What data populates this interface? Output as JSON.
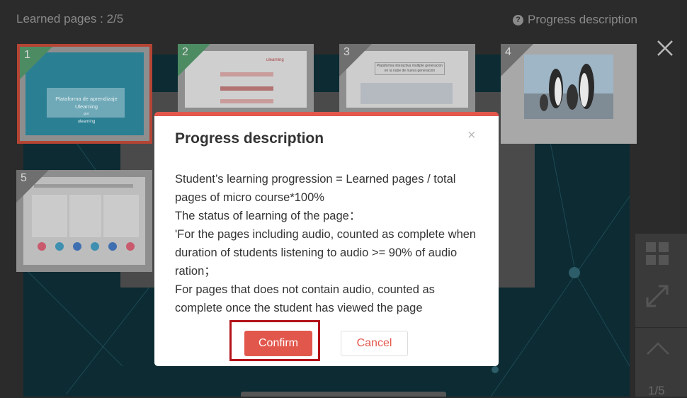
{
  "header": {
    "learned_pages": "Learned pages : 2/5",
    "progress_description_link": "Progress description"
  },
  "thumbnails": [
    {
      "number": "1",
      "status": "learned",
      "selected": true,
      "text": {
        "line1": "Plataforma de aprendizaje",
        "line2": "Ulearning",
        "brand": "ulearning",
        "brand_small": "por"
      }
    },
    {
      "number": "2",
      "status": "learned",
      "text": {
        "brand": "ulearning"
      }
    },
    {
      "number": "3",
      "status": "not-learned",
      "text": {
        "heading": "Plataforma interactiva multiple generacion en la nube de nueva generacion"
      }
    },
    {
      "number": "4",
      "status": "not-learned"
    },
    {
      "number": "5",
      "status": "not-learned"
    }
  ],
  "modal": {
    "title": "Progress description",
    "close_label": "×",
    "body": [
      "Student’s learning progression = Learned pages / total pages of micro course*100%",
      "The status of learning of the page：",
      "'For the pages including audio, counted as complete when duration of students listening to audio >= 90% of audio ration；",
      "For pages that does not contain audio, counted as complete once the student has viewed the page"
    ],
    "confirm_label": "Confirm",
    "cancel_label": "Cancel"
  },
  "rail": {
    "page_indicator": "1/5"
  },
  "colors": {
    "accent": "#e2574c",
    "learned_corner": "#4d8b63",
    "unlearned_corner": "#6f6f6f",
    "highlight_box": "#b3121a"
  },
  "icons": {
    "help": "question-circle-icon",
    "close": "close-icon",
    "grid": "grid-icon",
    "expand": "expand-icon",
    "scroll_up": "chevron-up-icon"
  }
}
